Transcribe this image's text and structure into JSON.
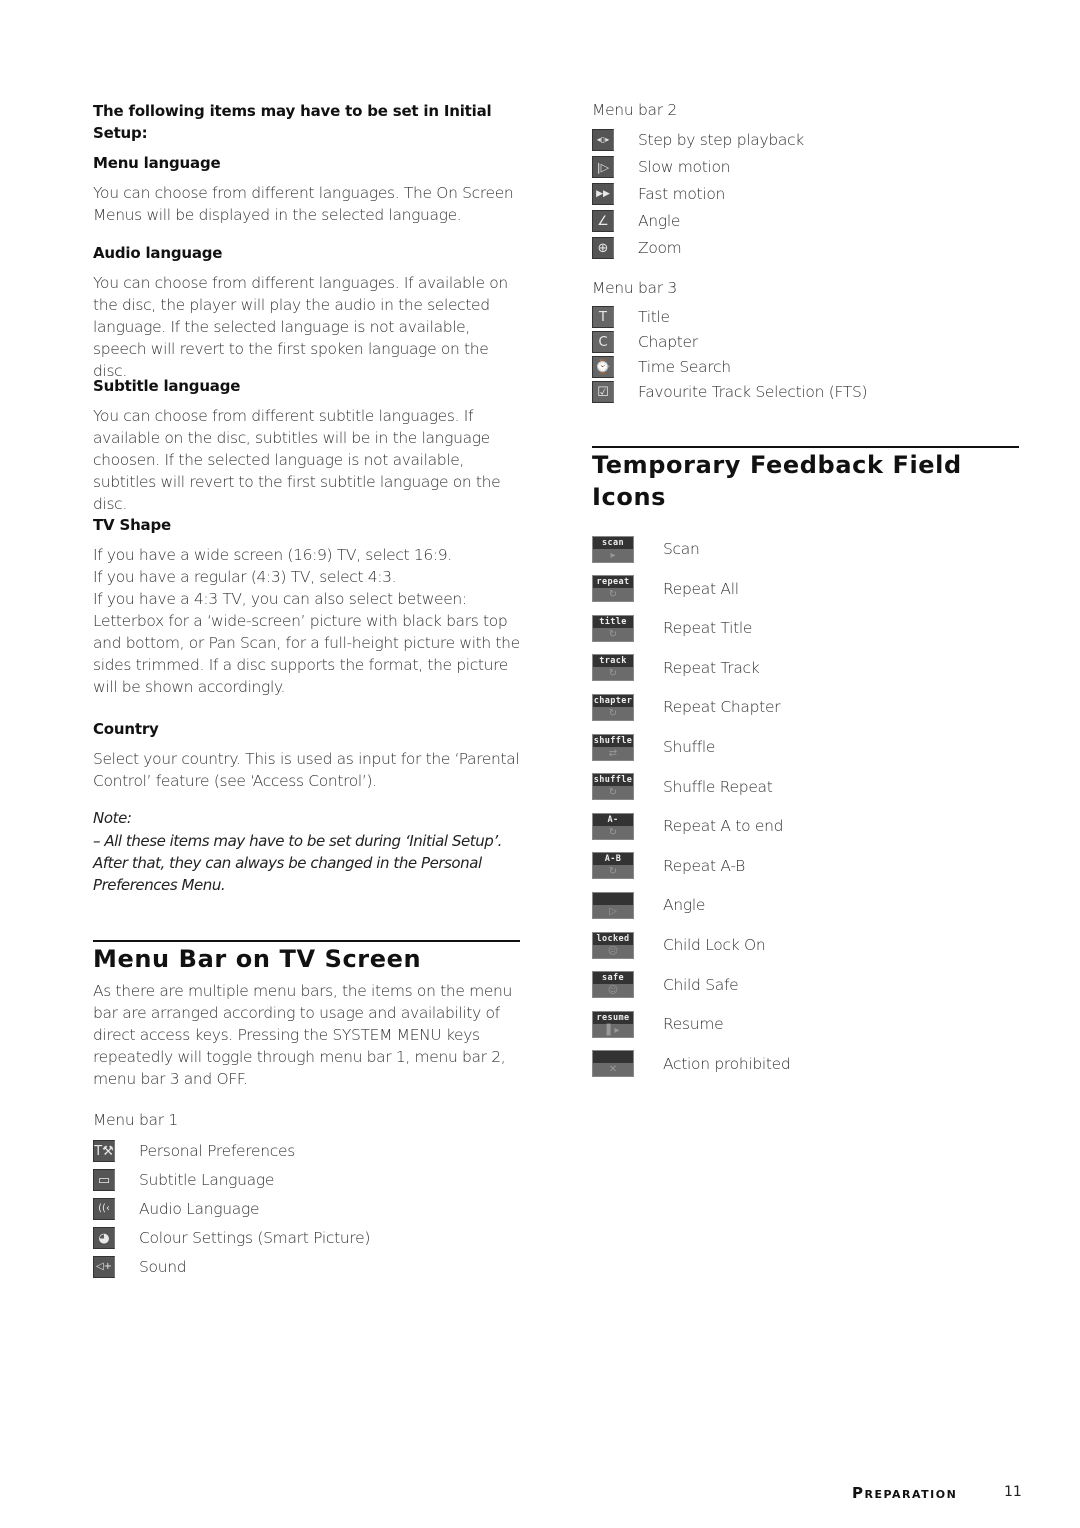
{
  "left": {
    "intro": "The following items may have to be set in Initial Setup:",
    "sections": [
      {
        "heading": "Menu language",
        "body": "You can choose from different languages. The On Screen Menus will be displayed in the selected language."
      },
      {
        "heading": "Audio language",
        "body": "You can choose from different languages. If available on the disc, the player will play the audio in the selected language. If the selected language is not available, speech will revert to the first spoken language on the disc."
      },
      {
        "heading": "Subtitle language",
        "body": "You can choose from different subtitle languages. If available on the disc, subtitles will be in the language choosen. If the selected language is not available, subtitles will revert to the first subtitle language on the disc."
      },
      {
        "heading": "TV Shape",
        "lines": [
          "If you have a wide screen (16:9) TV, select 16:9.",
          "If you have a regular (4:3) TV, select 4:3.",
          "If you have a 4:3 TV, you can also select between: Letterbox for a ‘wide-screen’ picture with black bars top and bottom, or Pan Scan, for a full-height picture with the sides trimmed. If a disc supports the format, the picture will be shown accordingly."
        ]
      },
      {
        "heading": "Country",
        "body": "Select your country. This is used as input for the ‘Parental Control’ feature (see ‘Access Control’)."
      }
    ],
    "note_label": "Note:",
    "note_text": "–  All these items may have to be set during ‘Initial Setup’. After that, they can always be changed in the Personal Preferences Menu.",
    "menu_bar_heading": "Menu Bar on TV Screen",
    "menu_bar_body": "As there are multiple menu bars, the items on the menu bar are arranged according to usage and availability of direct access keys. Pressing the SYSTEM MENU keys repeatedly will toggle through menu bar 1, menu bar 2, menu bar 3 and OFF.",
    "menu_bar_1": {
      "title": "Menu bar 1",
      "items": [
        {
          "icon": "personal-preferences-icon",
          "glyph": "T⚒",
          "label": "Personal Preferences"
        },
        {
          "icon": "subtitle-language-icon",
          "glyph": "▭",
          "label": "Subtitle Language"
        },
        {
          "icon": "audio-language-icon",
          "glyph": "((‹",
          "label": "Audio Language"
        },
        {
          "icon": "colour-settings-icon",
          "glyph": "◕",
          "label": "Colour Settings (Smart Picture)"
        },
        {
          "icon": "sound-icon",
          "glyph": "◁+",
          "label": "Sound"
        }
      ]
    }
  },
  "right": {
    "menu_bar_2": {
      "title": "Menu bar 2",
      "items": [
        {
          "icon": "step-by-step-icon",
          "glyph": "◂▯▸",
          "label": "Step by step playback"
        },
        {
          "icon": "slow-motion-icon",
          "glyph": "|▷",
          "label": "Slow motion"
        },
        {
          "icon": "fast-motion-icon",
          "glyph": "▶▶",
          "label": "Fast motion"
        },
        {
          "icon": "angle-icon",
          "glyph": "∠",
          "label": "Angle"
        },
        {
          "icon": "zoom-icon",
          "glyph": "⊕",
          "label": "Zoom"
        }
      ]
    },
    "menu_bar_3": {
      "title": "Menu bar 3",
      "items": [
        {
          "icon": "title-icon",
          "glyph": "T",
          "label": "Title"
        },
        {
          "icon": "chapter-icon",
          "glyph": "C",
          "label": "Chapter"
        },
        {
          "icon": "time-search-icon",
          "glyph": "⌚",
          "label": "Time Search"
        },
        {
          "icon": "fts-icon",
          "glyph": "☑",
          "label": "Favourite Track Selection (FTS)"
        }
      ]
    },
    "feedback_heading": "Temporary Feedback Field Icons",
    "feedback_items": [
      {
        "icon": "scan-icon",
        "tag": "scan",
        "glyph": "▸",
        "label": "Scan"
      },
      {
        "icon": "repeat-all-icon",
        "tag": "repeat",
        "glyph": "↻",
        "label": "Repeat All"
      },
      {
        "icon": "repeat-title-icon",
        "tag": "title",
        "glyph": "↻",
        "label": "Repeat Title"
      },
      {
        "icon": "repeat-track-icon",
        "tag": "track",
        "glyph": "↻",
        "label": "Repeat Track"
      },
      {
        "icon": "repeat-chapter-icon",
        "tag": "chapter",
        "glyph": "↻",
        "label": "Repeat Chapter"
      },
      {
        "icon": "shuffle-icon",
        "tag": "shuffle",
        "glyph": "⇄",
        "label": "Shuffle"
      },
      {
        "icon": "shuffle-repeat-icon",
        "tag": "shuffle",
        "glyph": "↻",
        "label": "Shuffle Repeat"
      },
      {
        "icon": "repeat-a-to-end-icon",
        "tag": "A-",
        "glyph": "↻",
        "label": "Repeat A to end"
      },
      {
        "icon": "repeat-a-b-icon",
        "tag": "A-B",
        "glyph": "↻",
        "label": "Repeat A-B"
      },
      {
        "icon": "angle-feedback-icon",
        "tag": "",
        "glyph": "▷",
        "label": "Angle"
      },
      {
        "icon": "child-lock-icon",
        "tag": "locked",
        "glyph": "☹",
        "label": "Child Lock On"
      },
      {
        "icon": "child-safe-icon",
        "tag": "safe",
        "glyph": "☺",
        "label": "Child Safe"
      },
      {
        "icon": "resume-icon",
        "tag": "resume",
        "glyph": "▌▸",
        "label": "Resume"
      },
      {
        "icon": "action-prohibited-icon",
        "tag": "",
        "glyph": "✕",
        "label": "Action prohibited"
      }
    ]
  },
  "footer": {
    "section": "Preparation",
    "page": "11"
  }
}
